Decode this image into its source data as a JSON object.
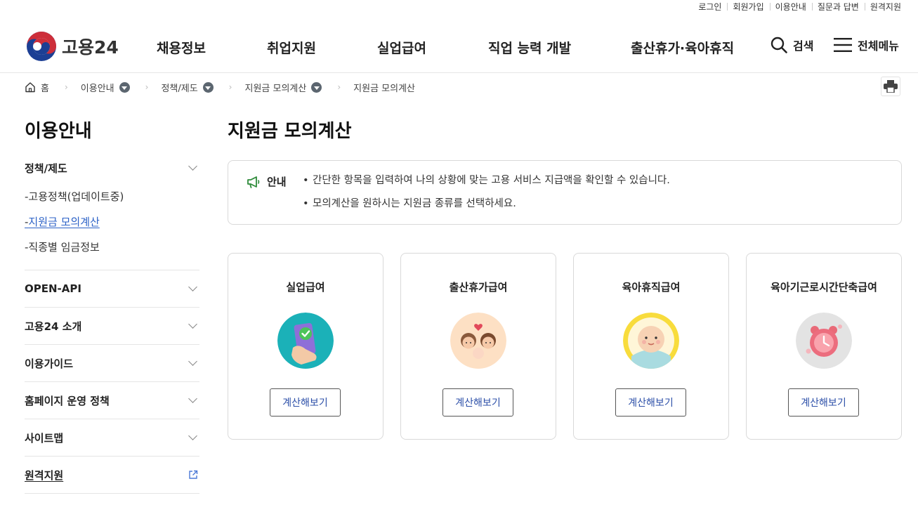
{
  "util_links": [
    "로그인",
    "회원가입",
    "이용안내",
    "질문과 답변",
    "원격지원"
  ],
  "logo": {
    "text": "고용24",
    "icon": "taegeuk-emblem"
  },
  "gnb": [
    "채용정보",
    "취업지원",
    "실업급여",
    "직업 능력 개발",
    "출산휴가·육아휴직"
  ],
  "header": {
    "search_label": "검색",
    "allmenu_label": "전체메뉴"
  },
  "breadcrumb": {
    "home": "홈",
    "items": [
      "이용안내",
      "정책/제도",
      "지원금 모의계산"
    ],
    "current": "지원금 모의계산"
  },
  "lnb": {
    "title": "이용안내",
    "groups": [
      {
        "label": "정책/제도",
        "sub": [
          "고용정책(업데이트중)",
          "지원금 모의계산",
          "직종별 임금정보"
        ],
        "active_sub": "지원금 모의계산"
      },
      {
        "label": "OPEN-API"
      },
      {
        "label": "고용24 소개"
      },
      {
        "label": "이용가이드"
      },
      {
        "label": "홈페이지 운영 정책"
      },
      {
        "label": "사이트맵"
      },
      {
        "label": "원격지원",
        "external": true
      }
    ]
  },
  "main": {
    "title": "지원금 모의계산",
    "notice": {
      "label": "안내",
      "items": [
        "간단한 항목을 입력하여 나의 상황에 맞는 고용 서비스 지급액을 확인할 수 있습니다.",
        "모의계산을 원하시는 지원금 종류를 선택하세요."
      ]
    },
    "cards": [
      {
        "title": "실업급여",
        "button": "계산해보기",
        "icon": "phone-check-icon"
      },
      {
        "title": "출산휴가급여",
        "button": "계산해보기",
        "icon": "family-icon"
      },
      {
        "title": "육아휴직급여",
        "button": "계산해보기",
        "icon": "baby-icon"
      },
      {
        "title": "육아기근로시간단축급여",
        "button": "계산해보기",
        "icon": "alarm-clock-icon"
      }
    ]
  },
  "colors": {
    "accent_blue": "#2c62c7",
    "button_text": "#2c4fa8",
    "notice_green": "#2e8b3a"
  }
}
